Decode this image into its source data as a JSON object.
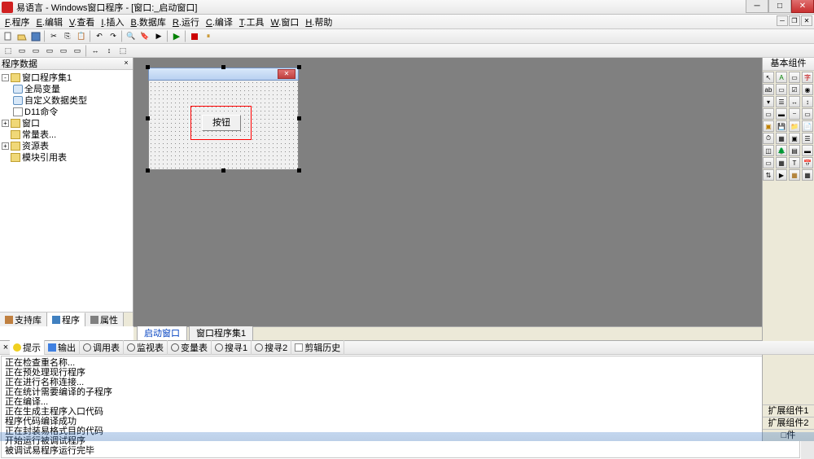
{
  "window": {
    "title": "易语言 - Windows窗口程序 - [窗口:_启动窗口]"
  },
  "menu": {
    "items": [
      {
        "u": "F",
        "label": "程序"
      },
      {
        "u": "E",
        "label": "编辑"
      },
      {
        "u": "V",
        "label": "查看"
      },
      {
        "u": "I",
        "label": "插入"
      },
      {
        "u": "B",
        "label": "数据库"
      },
      {
        "u": "R",
        "label": "运行"
      },
      {
        "u": "C",
        "label": "编译"
      },
      {
        "u": "T",
        "label": "工具"
      },
      {
        "u": "W",
        "label": "窗口"
      },
      {
        "u": "H",
        "label": "帮助"
      }
    ]
  },
  "left_panel": {
    "header": "程序数据",
    "tabs": [
      {
        "label": "支持库",
        "icon": "book"
      },
      {
        "label": "程序",
        "icon": "prog",
        "active": true
      },
      {
        "label": "属性",
        "icon": "prop"
      }
    ],
    "tree": [
      {
        "indent": 0,
        "expand": "-",
        "icon": "folder",
        "label": "窗口程序集1"
      },
      {
        "indent": 1,
        "expand": "",
        "icon": "db",
        "label": "全局变量"
      },
      {
        "indent": 1,
        "expand": "",
        "icon": "db",
        "label": "自定义数据类型"
      },
      {
        "indent": 1,
        "expand": "",
        "icon": "page",
        "label": "D11命令"
      },
      {
        "indent": 0,
        "expand": "+",
        "icon": "folder",
        "label": "窗口"
      },
      {
        "indent": 0,
        "expand": "",
        "icon": "folder",
        "label": "常量表..."
      },
      {
        "indent": 0,
        "expand": "+",
        "icon": "folder",
        "label": "资源表"
      },
      {
        "indent": 0,
        "expand": "",
        "icon": "folder",
        "label": "模块引用表"
      }
    ]
  },
  "designer": {
    "tabs": [
      {
        "label": "启动窗口",
        "active": true
      },
      {
        "label": "窗口程序集1",
        "active": false
      }
    ],
    "button_label": "按钮"
  },
  "toolbox": {
    "header": "基本组件",
    "sections": [
      "扩展组件1",
      "扩展组件2",
      "□件"
    ]
  },
  "bottom": {
    "tabs": [
      {
        "label": "提示",
        "icon": "bulb",
        "active": true
      },
      {
        "label": "输出",
        "icon": "arrow"
      },
      {
        "label": "调用表",
        "icon": "mag"
      },
      {
        "label": "监视表",
        "icon": "mag"
      },
      {
        "label": "变量表",
        "icon": "mag"
      },
      {
        "label": "搜寻1",
        "icon": "mag"
      },
      {
        "label": "搜寻2",
        "icon": "mag"
      },
      {
        "label": "剪辑历史",
        "icon": "page"
      }
    ],
    "lines": [
      "正在检查重名称...",
      "正在预处理现行程序",
      "正在进行名称连接...",
      "正在统计需要编译的子程序",
      "正在编译...",
      "正在生成主程序入口代码",
      "程序代码编译成功",
      "正在封装易格式目的代码",
      "开始运行被调试程序",
      "被调试易程序运行完毕"
    ]
  }
}
